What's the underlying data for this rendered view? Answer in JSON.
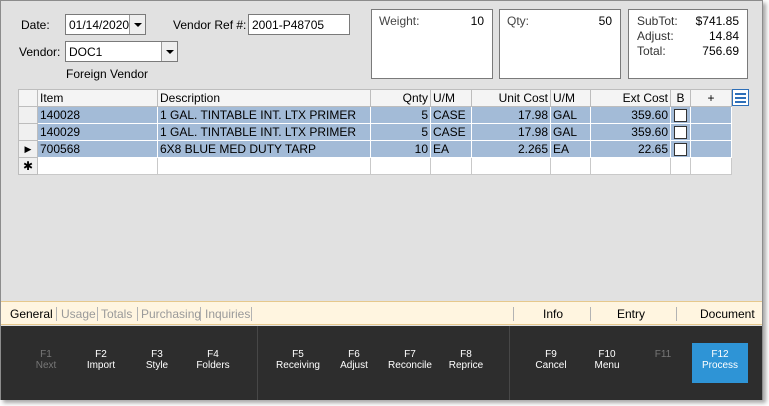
{
  "header": {
    "date_label": "Date:",
    "date_value": "01/14/2020",
    "vendor_ref_label": "Vendor Ref #:",
    "vendor_ref_value": "2001-P48705",
    "vendor_label": "Vendor:",
    "vendor_value": "DOC1",
    "vendor_name": "Foreign Vendor"
  },
  "weight": {
    "label": "Weight:",
    "value": "10"
  },
  "qty": {
    "label": "Qty:",
    "value": "50"
  },
  "totals": {
    "subtot_label": "SubTot:",
    "subtot_value": "$741.85",
    "adjust_label": "Adjust:",
    "adjust_value": "14.84",
    "total_label": "Total:",
    "total_value": "756.69"
  },
  "grid": {
    "columns": [
      "Item",
      "Description",
      "Qnty",
      "U/M",
      "Unit Cost",
      "U/M",
      "Ext Cost",
      "B",
      "+"
    ],
    "rows": [
      {
        "item": "140028",
        "description": "1 GAL. TINTABLE INT. LTX PRIMER",
        "qnty": "5",
        "um": "CASE",
        "unit_cost": "17.98",
        "um2": "GAL",
        "ext_cost": "359.60",
        "b": false
      },
      {
        "item": "140029",
        "description": "1 GAL. TINTABLE INT. LTX PRIMER",
        "qnty": "5",
        "um": "CASE",
        "unit_cost": "17.98",
        "um2": "GAL",
        "ext_cost": "359.60",
        "b": false
      },
      {
        "item": "700568",
        "description": "6X8 BLUE MED DUTY TARP",
        "qnty": "10",
        "um": "EA",
        "unit_cost": "2.265",
        "um2": "EA",
        "ext_cost": "22.65",
        "b": false
      }
    ],
    "new_row_marker": "✱",
    "current_row_marker": "▶"
  },
  "tabs": {
    "general": "General",
    "usage": "Usage",
    "totals": "Totals",
    "purchasing": "Purchasing",
    "inquiries": "Inquiries",
    "info": "Info",
    "entry": "Entry",
    "document": "Document"
  },
  "fkeys": [
    {
      "key": "F1",
      "label": "Next"
    },
    {
      "key": "F2",
      "label": "Import"
    },
    {
      "key": "F3",
      "label": "Style"
    },
    {
      "key": "F4",
      "label": "Folders"
    },
    {
      "key": "F5",
      "label": "Receiving"
    },
    {
      "key": "F6",
      "label": "Adjust"
    },
    {
      "key": "F7",
      "label": "Reconcile"
    },
    {
      "key": "F8",
      "label": "Reprice"
    },
    {
      "key": "F9",
      "label": "Cancel"
    },
    {
      "key": "F10",
      "label": "Menu"
    },
    {
      "key": "F11",
      "label": ""
    },
    {
      "key": "F12",
      "label": "Process"
    }
  ],
  "colors": {
    "selected_row": "#a3bbd7",
    "accent": "#2e94d6",
    "function_bar": "#2d2d2d",
    "tab_strip": "#fff5e0"
  }
}
